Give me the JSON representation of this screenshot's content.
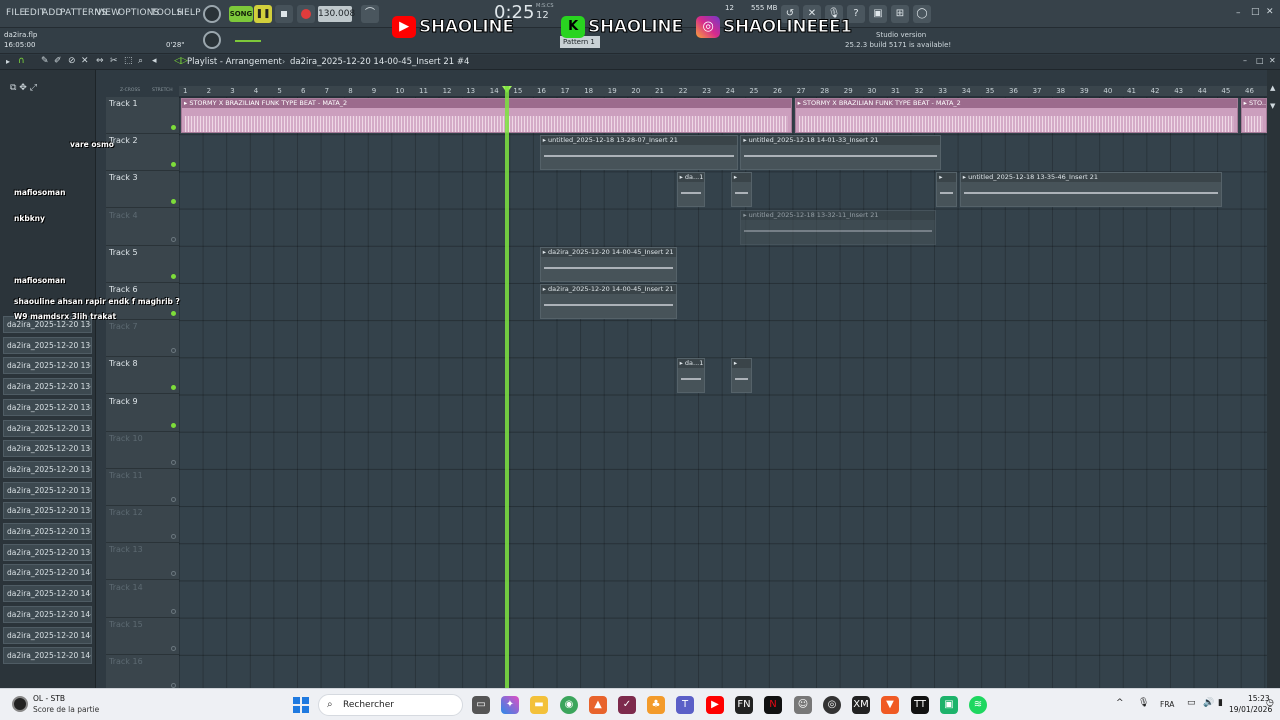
{
  "menu": [
    "FILE",
    "EDIT",
    "ADD",
    "PATTERNS",
    "VIEW",
    "OPTIONS",
    "TOOLS",
    "HELP"
  ],
  "transport": {
    "mode": "SONG",
    "tempo": "130.008",
    "time": "0:25",
    "time_small": "12",
    "ms_label": "M:S:CS",
    "memory": "555 MB",
    "cpu": "12"
  },
  "project": {
    "filename": "da2ira.flp",
    "time": "16:05:00",
    "position": "0'28\""
  },
  "pattern": {
    "label": "Pattern 1"
  },
  "update_notice": {
    "line1": "Studio version",
    "line2": "25.2.3 build 5171 is available!"
  },
  "banners": [
    {
      "text": "SHAOLINE",
      "logo": "▶",
      "color": "#ff0000"
    },
    {
      "text": "SHAOLINE",
      "logo": "K",
      "color": "#29d420"
    },
    {
      "text": "SHAOLINEEE1",
      "logo": "◎",
      "color": "#d62a8c"
    }
  ],
  "playlist": {
    "title": "Playlist - Arrangement",
    "clip_name": "da2ira_2025-12-20 14-00-45_Insert 21 #4",
    "zcross": "Z-CROSS",
    "stretch": "STRETCH"
  },
  "ruler": [
    "1",
    "2",
    "3",
    "4",
    "5",
    "6",
    "7",
    "8",
    "9",
    "10",
    "11",
    "12",
    "13",
    "14",
    "15",
    "16",
    "17",
    "18",
    "19",
    "20",
    "21",
    "22",
    "23",
    "24",
    "25",
    "26",
    "27",
    "28",
    "29",
    "30",
    "31",
    "32",
    "33",
    "34",
    "35",
    "36",
    "37",
    "38",
    "39",
    "40",
    "41",
    "42",
    "43",
    "44",
    "45",
    "46"
  ],
  "tracks": [
    {
      "name": "Track 1",
      "active": true
    },
    {
      "name": "Track 2",
      "active": true
    },
    {
      "name": "Track 3",
      "active": true
    },
    {
      "name": "Track 4",
      "active": false
    },
    {
      "name": "Track 5",
      "active": true
    },
    {
      "name": "Track 6",
      "active": true
    },
    {
      "name": "Track 7",
      "active": false
    },
    {
      "name": "Track 8",
      "active": true
    },
    {
      "name": "Track 9",
      "active": true
    },
    {
      "name": "Track 10",
      "active": false
    },
    {
      "name": "Track 11",
      "active": false
    },
    {
      "name": "Track 12",
      "active": false
    },
    {
      "name": "Track 13",
      "active": false
    },
    {
      "name": "Track 14",
      "active": false
    },
    {
      "name": "Track 15",
      "active": false
    },
    {
      "name": "Track 16",
      "active": false
    }
  ],
  "clips": [
    {
      "label": "STORMY X BRAZILIAN FUNK TYPE BEAT - MATA_2",
      "track": 0,
      "start": 1,
      "end": 26.9,
      "pink": true
    },
    {
      "label": "STORMY X BRAZILIAN FUNK TYPE BEAT - MATA_2",
      "track": 0,
      "start": 27,
      "end": 45.8,
      "pink": true
    },
    {
      "label": "STO...2",
      "track": 0,
      "start": 45.9,
      "end": 47,
      "pink": true
    },
    {
      "label": "untitled_2025-12-18 13-28-07_Insert 21",
      "track": 1,
      "start": 16.2,
      "end": 24.6
    },
    {
      "label": "untitled_2025-12-18 14-01-33_Insert 21",
      "track": 1,
      "start": 24.7,
      "end": 33.2
    },
    {
      "label": "da...1",
      "track": 2,
      "start": 22,
      "end": 23.2
    },
    {
      "label": "",
      "track": 2,
      "start": 24.3,
      "end": 25.2
    },
    {
      "label": "",
      "track": 2,
      "start": 33,
      "end": 33.9
    },
    {
      "label": "untitled_2025-12-18 13-35-46_Insert 21",
      "track": 2,
      "start": 34,
      "end": 45.1
    },
    {
      "label": "untitled_2025-12-18 13-32-11_Insert 21",
      "track": 3,
      "start": 24.7,
      "end": 33,
      "dim": true
    },
    {
      "label": "da2ira_2025-12-20 14-00-45_Insert 21 #4",
      "track": 4,
      "start": 16.2,
      "end": 22
    },
    {
      "label": "da2ira_2025-12-20 14-00-45_Insert 21 #3",
      "track": 5,
      "start": 16.2,
      "end": 22
    },
    {
      "label": "da...1",
      "track": 7,
      "start": 22,
      "end": 23.2
    },
    {
      "label": "",
      "track": 7,
      "start": 24.3,
      "end": 25.2
    }
  ],
  "browser_items": [
    "da2ira_2025-12-20 13-5...",
    "da2ira_2025-12-20 13-5...",
    "da2ira_2025-12-20 13-5...",
    "da2ira_2025-12-20 13-5...",
    "da2ira_2025-12-20 13-5...",
    "da2ira_2025-12-20 13-5...",
    "da2ira_2025-12-20 13-5...",
    "da2ira_2025-12-20 13-5...",
    "da2ira_2025-12-20 13-5...",
    "da2ira_2025-12-20 13-5...",
    "da2ira_2025-12-20 13-5...",
    "da2ira_2025-12-20 13-5...",
    "da2ira_2025-12-20 14-0...",
    "da2ira_2025-12-20 14-0...",
    "da2ira_2025-12-20 14-0...",
    "da2ira_2025-12-20 14-0...",
    "da2ira_2025-12-20 14-0..."
  ],
  "chat": [
    {
      "user": "mafiosoman",
      "msg": ""
    },
    {
      "user": "nkbkny",
      "msg": ""
    },
    {
      "user": "mafiosoman",
      "msg": ""
    },
    {
      "user": "",
      "msg": "shaouline ahsan rapir endk f maghrib ?"
    },
    {
      "user": "",
      "msg": "W9 mamdsrx 3lih trakat"
    },
    {
      "user": "",
      "msg": "vare osmo"
    }
  ],
  "taskbar": {
    "widget_title": "OL - STB",
    "widget_sub": "Score de la partie",
    "search": "Rechercher",
    "lang": "FRA",
    "clock": "15:23",
    "date": "19/01/2026"
  }
}
